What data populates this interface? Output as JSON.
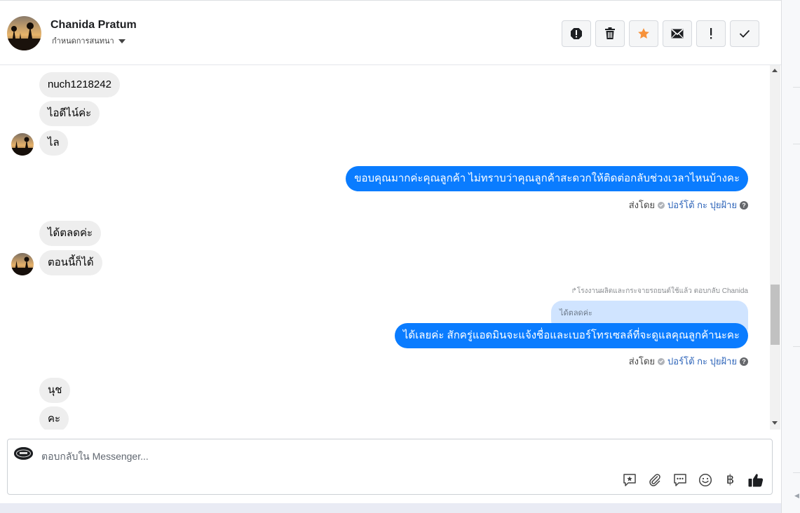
{
  "header": {
    "name": "Chanida Pratum",
    "assign_label": "กำหนดการสนทนา"
  },
  "messages": {
    "in1": "nuch1218242",
    "in2": "ไอดีไน์ค่ะ",
    "in3": "ไล",
    "out1": "ขอบคุณมากค่ะคุณลูกค้า ไม่ทราบว่าคุณลูกค้าสะดวกให้ติดต่อกลับช่วงเวลาไหนบ้างคะ",
    "in4": "ได้ตลดค่ะ",
    "in5": "ตอนนี้ก็ได้",
    "reply_context": "↱โรงงานผลิตและกระจายรถยนต์ใช้แล้ว ตอบกลับ Chanida",
    "quoted": "ได้ตลดค่ะ",
    "out2": "ได้เลยค่ะ สักครู่แอดมินจะแจ้งชื่อและเบอร์โทรเซลล์ที่จะดูแลคุณลูกค้านะคะ",
    "in6": "นุช",
    "in7": "คะ"
  },
  "sent_by": {
    "label": "ส่งโดย",
    "agent": "ปอร์โต้ กะ ปุยฝ้าย",
    "help": "?"
  },
  "composer": {
    "placeholder": "ตอบกลับใน Messenger...",
    "tools": [
      "saved-reply-icon",
      "attachment-icon",
      "chat-bubble-icon",
      "emoji-icon",
      "baht-icon",
      "thumbs-up-icon"
    ],
    "baht": "฿"
  },
  "header_actions": [
    "report-icon",
    "trash-icon",
    "star-icon",
    "mail-icon",
    "exclamation-icon",
    "check-icon"
  ],
  "colors": {
    "outgoing": "#0a7cff",
    "incoming": "#eeeeee",
    "star": "#f7923a"
  }
}
